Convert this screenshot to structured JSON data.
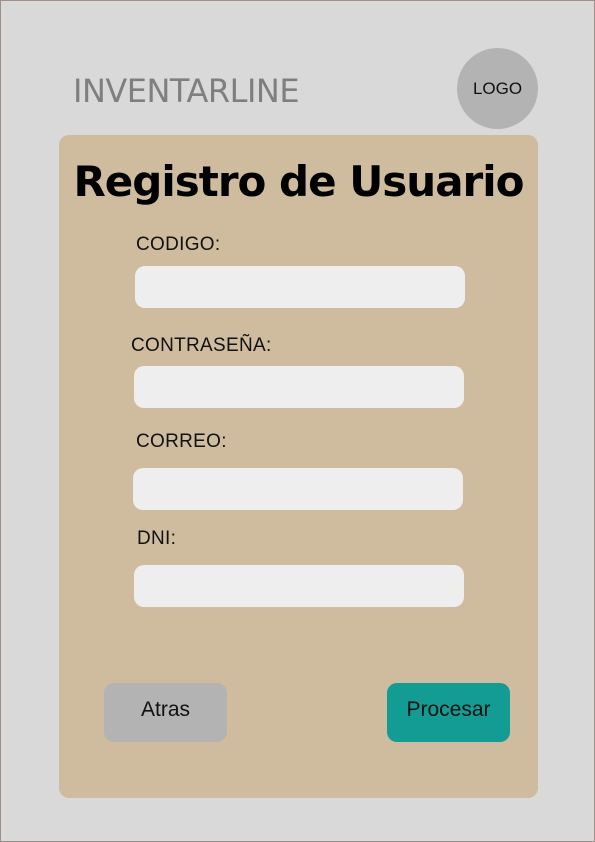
{
  "header": {
    "brand": "INVENTARLINE",
    "logo_text": "LOGO"
  },
  "form": {
    "title": "Registro de Usuario",
    "fields": [
      {
        "label": "CODIGO:",
        "value": ""
      },
      {
        "label": "CONTRASEÑA:",
        "value": ""
      },
      {
        "label": "CORREO:",
        "value": ""
      },
      {
        "label": "DNI:",
        "value": ""
      }
    ],
    "back_label": "Atras",
    "process_label": "Procesar"
  },
  "colors": {
    "page_bg": "#d9d9d9",
    "card_bg": "#cfbc9e",
    "input_bg": "#eeeeee",
    "back_button": "#b3b3b3",
    "process_button": "#139c94",
    "logo_bg": "#b3b3b3"
  }
}
